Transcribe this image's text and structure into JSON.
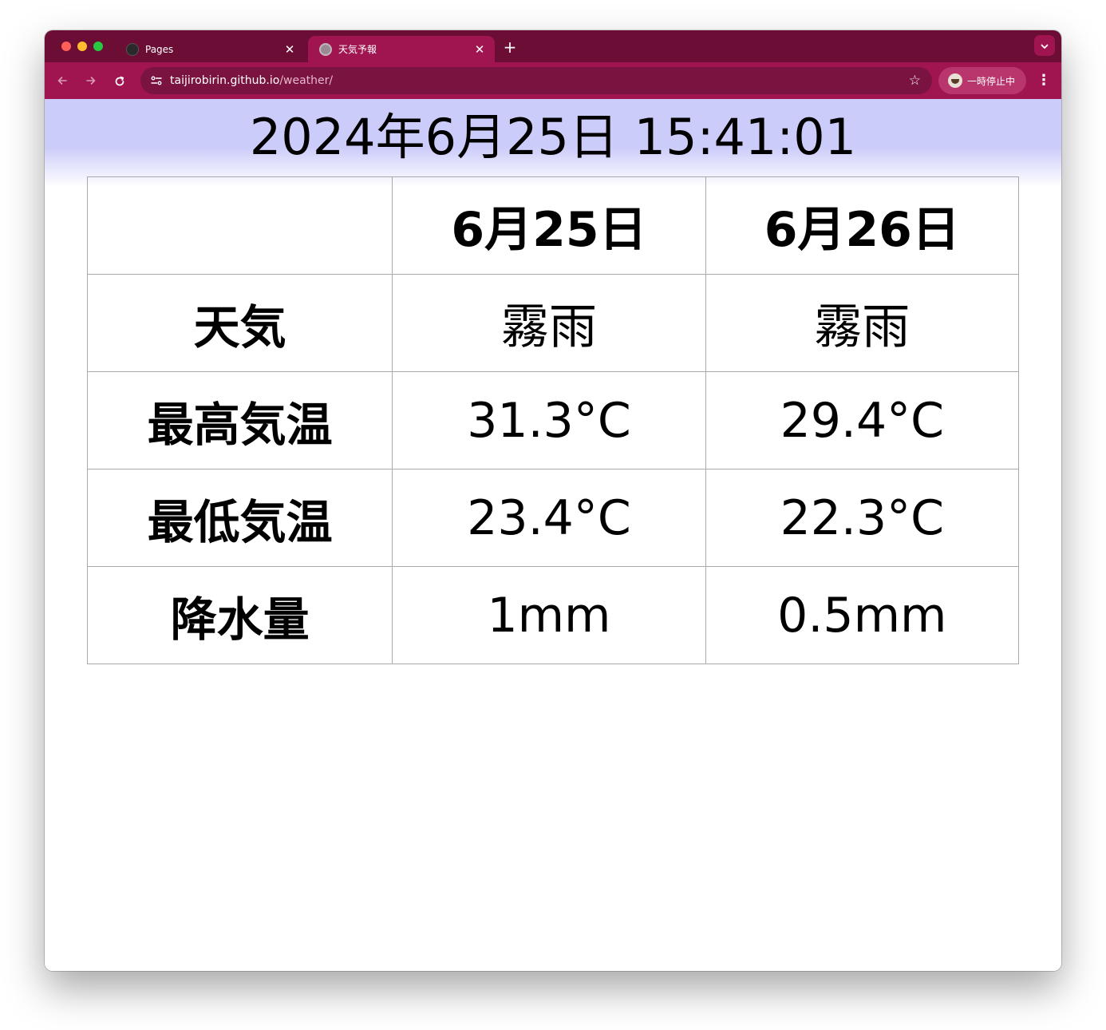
{
  "browser": {
    "tabs": [
      {
        "title": "Pages",
        "favicon": "github-icon",
        "active": false
      },
      {
        "title": "天気予報",
        "favicon": "globe-icon",
        "active": true
      }
    ],
    "new_tab_label": "+",
    "tab_close_glyph": "✕",
    "url_host": "taijirobirin.github.io",
    "url_path": "/weather/",
    "profile_status": "一時停止中",
    "accent_color": "#a0144f",
    "tabstrip_color": "#6b0d34"
  },
  "page": {
    "clock": "2024年6月25日 15:41:01",
    "banner_color": "#ccccfa",
    "table": {
      "corner": "",
      "days": [
        "6月25日",
        "6月26日"
      ],
      "rows": [
        {
          "label": "天気",
          "values": [
            "霧雨",
            "霧雨"
          ]
        },
        {
          "label": "最高気温",
          "values": [
            "31.3°C",
            "29.4°C"
          ]
        },
        {
          "label": "最低気温",
          "values": [
            "23.4°C",
            "22.3°C"
          ]
        },
        {
          "label": "降水量",
          "values": [
            "1mm",
            "0.5mm"
          ]
        }
      ]
    }
  }
}
